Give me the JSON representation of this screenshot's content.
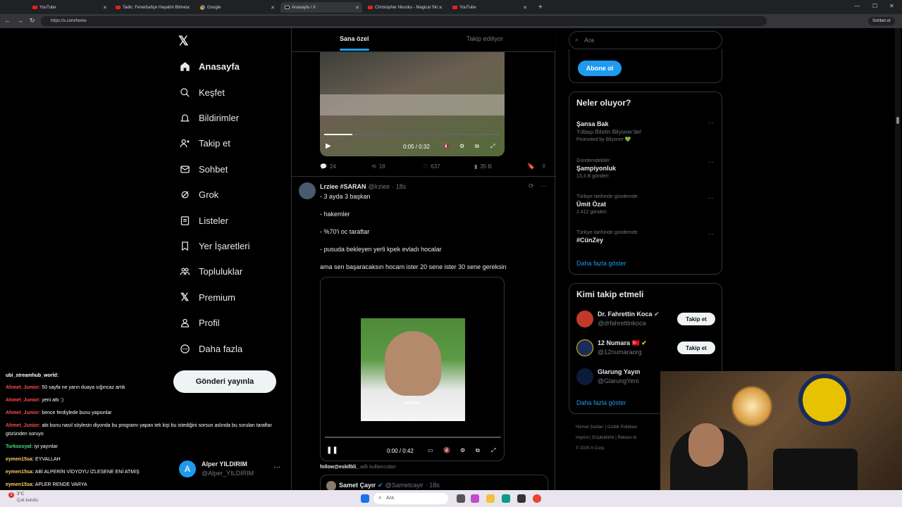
{
  "browser": {
    "tabs": [
      {
        "title": "YouTube",
        "favicon": "youtube-icon"
      },
      {
        "title": "Tadic: Fenerbahçe Hayalim Bitmei",
        "favicon": "youtube-icon"
      },
      {
        "title": "Google",
        "favicon": "google-icon"
      },
      {
        "title": "Anasayfa / X",
        "favicon": "x-icon",
        "active": true
      },
      {
        "title": "Christopher Nkunku - Magical Ski",
        "favicon": "youtube-icon"
      },
      {
        "title": "YouTube",
        "favicon": "youtube-icon"
      }
    ],
    "url": "https://x.com/home",
    "profile_label": "Sohbet et"
  },
  "sidebar": {
    "items": [
      {
        "label": "Anasayfa",
        "icon": "home-icon"
      },
      {
        "label": "Keşfet",
        "icon": "search-icon"
      },
      {
        "label": "Bildirimler",
        "icon": "bell-icon"
      },
      {
        "label": "Takip et",
        "icon": "follow-icon"
      },
      {
        "label": "Sohbet",
        "icon": "mail-icon"
      },
      {
        "label": "Grok",
        "icon": "grok-icon"
      },
      {
        "label": "Listeler",
        "icon": "list-icon"
      },
      {
        "label": "Yer İşaretleri",
        "icon": "bookmark-icon"
      },
      {
        "label": "Topluluklar",
        "icon": "communities-icon"
      },
      {
        "label": "Premium",
        "icon": "x-premium-icon"
      },
      {
        "label": "Profil",
        "icon": "profile-icon"
      },
      {
        "label": "Daha fazla",
        "icon": "more-icon"
      }
    ],
    "post_button": "Gönderi yayınla",
    "account": {
      "name": "Alper YILDIRIM",
      "handle": "@Alper_YILDIRIM",
      "initial": "A"
    }
  },
  "feed": {
    "tabs": [
      "Sana özel",
      "Takip ediliyor"
    ],
    "video1": {
      "time": "0:05 / 0:32",
      "progress": 0.16
    },
    "actions1": {
      "replies": "24",
      "reposts": "18",
      "likes": "637",
      "views": "35 B"
    },
    "tweet": {
      "name": "Lrziee #SARAN",
      "handle": "@lrziee",
      "time": "· 18s",
      "lines": [
        "- 3 ayda 3 başkan",
        "- hakemler",
        "- %70'i oc taraftar",
        "- pusuda bekleyen yerli kpek evladı hocalar",
        "ama sen başaracaksın hocam ister 20 sene ister 30 sene gereksin"
      ],
      "video_time": "0:00 / 0:42",
      "watermark": "eskifbli",
      "attribution_user": "follow@eskifbli_",
      "attribution_rest": " adlı kullanıcıdan"
    },
    "quoted": {
      "name": "Samet Çayır",
      "handle": "@Sametcayir",
      "time": "· 18s"
    }
  },
  "right": {
    "search_placeholder": "Ara",
    "subscribe": "Abone ol",
    "trends_title": "Neler oluyor?",
    "trends": [
      {
        "title": "Şansa Bak",
        "sub": "Yılbaşı Biletin Bilyoner'de!",
        "meta": "Promoted by Bilyoner 💚"
      },
      {
        "context": "Gündemdekiler",
        "title": "Şampiyonluk",
        "meta": "13,3 B gönderi"
      },
      {
        "context": "Türkiye tarihinde gündemde",
        "title": "Ümit Özat",
        "meta": "2.412 gönderi"
      },
      {
        "context": "Türkiye tarihinde gündemde",
        "title": "#CünZey",
        "meta": ""
      }
    ],
    "show_more": "Daha fazla göster",
    "wtf_title": "Kimi takip etmeli",
    "wtf": [
      {
        "name": "Dr. Fahrettin Koca",
        "handle": "@drfahrettinkoca",
        "button": "Takip et"
      },
      {
        "name": "12 Numara 🇹🇷",
        "handle": "@12numaraorg",
        "button": "Takip et"
      },
      {
        "name": "Glarung Yayın",
        "handle": "@GlarungYeni",
        "button": ""
      }
    ],
    "show_more2": "Daha fazla göster",
    "footer": [
      "Hizmet Şartları",
      "Gizlilik Politikası",
      "Imprint",
      "Erişilebilirlik",
      "Reklam bi",
      "© 2025 X Corp."
    ]
  },
  "chat": [
    {
      "user": "ubi_streamhub_world:",
      "msg": "",
      "color": "#ffffff"
    },
    {
      "user": "Ahmet_Junior:",
      "msg": " 50 sayfa ne yarın duaya sığıncaz artık",
      "color": "#ff4d4d"
    },
    {
      "user": "Ahmet_Junior:",
      "msg": " yeni attı :)",
      "color": "#ff4d4d"
    },
    {
      "user": "Ahmet_Junior:",
      "msg": " bence ferdiylede bunu yapsınlar",
      "color": "#ff4d4d"
    },
    {
      "user": "Ahmet_Junior:",
      "msg": " abi bunu nasıl söylesin diyonda bu programı yapan tek kişi bu istediğini sorsun aslında bu sorulan taraftar",
      "color": "#ff4d4d"
    },
    {
      "user": "",
      "msg": "gözünden soruyo",
      "color": "#ffffff"
    },
    {
      "user": "Turksosyal:",
      "msg": " iyi yayınlar",
      "color": "#4ade80"
    },
    {
      "user": "eymen15sa:",
      "msg": " EYVALLAH",
      "color": "#ffd166"
    },
    {
      "user": "eymen15sa:",
      "msg": " ABİ ALPERİN VİDYOYU İZLESENE ENİ ATMIŞ",
      "color": "#ffd166"
    },
    {
      "user": "eymen15sa:",
      "msg": " APLER RENDE VARYA",
      "color": "#ffd166"
    }
  ],
  "taskbar": {
    "search": "Ara",
    "weather_temp": "3°C",
    "weather_text": "Çok bulutlu",
    "notif_count": "3"
  }
}
